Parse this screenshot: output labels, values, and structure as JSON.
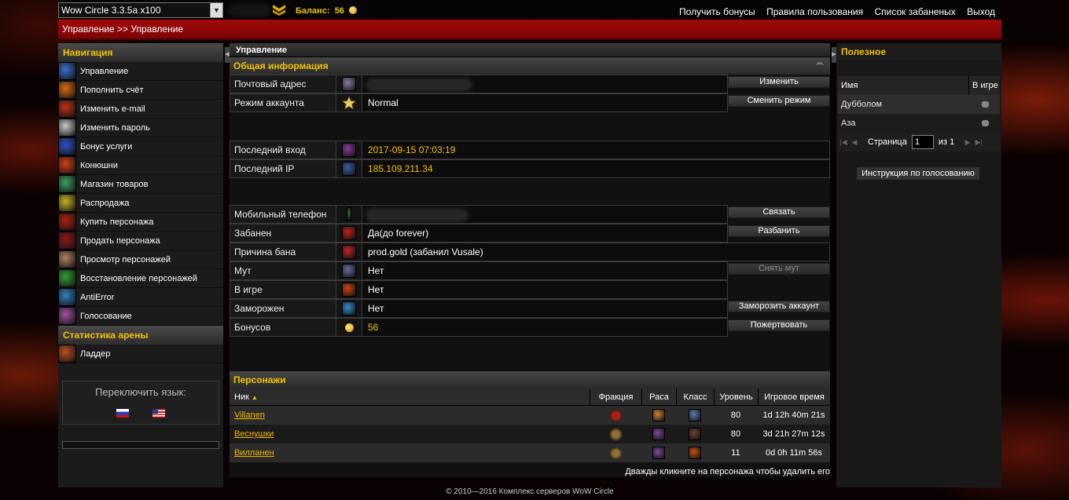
{
  "topbar": {
    "server_select": "Wow Circle 3.3.5a x100",
    "balance_label": "Баланс:",
    "balance_value": "56",
    "links": [
      "Получить бонусы",
      "Правила пользования",
      "Список забаненых",
      "Выход"
    ]
  },
  "breadcrumb": "Управление >> Управление",
  "left": {
    "nav_title": "Навигация",
    "nav_items": [
      {
        "label": "Управление",
        "icon": "management-icon",
        "color": "#3a6fd0"
      },
      {
        "label": "Пополнить счёт",
        "icon": "deposit-icon",
        "color": "#d86a10"
      },
      {
        "label": "Изменить e-mail",
        "icon": "email-icon",
        "color": "#c03010"
      },
      {
        "label": "Изменить пароль",
        "icon": "password-icon",
        "color": "#c8c8c8"
      },
      {
        "label": "Бонус услуги",
        "icon": "bonus-services-icon",
        "color": "#3050c8"
      },
      {
        "label": "Конюшни",
        "icon": "stables-icon",
        "color": "#d04010"
      },
      {
        "label": "Магазин товаров",
        "icon": "shop-icon",
        "color": "#3aa060"
      },
      {
        "label": "Распродажа",
        "icon": "sale-icon",
        "color": "#c8b020"
      },
      {
        "label": "Купить персонажа",
        "icon": "buy-character-icon",
        "color": "#b02010"
      },
      {
        "label": "Продать персонажа",
        "icon": "sell-character-icon",
        "color": "#901818"
      },
      {
        "label": "Просмотр персонажей",
        "icon": "view-characters-icon",
        "color": "#b08060"
      },
      {
        "label": "Восстановление персонажей",
        "icon": "restore-characters-icon",
        "color": "#30a030"
      },
      {
        "label": "AntiError",
        "icon": "antierror-icon",
        "color": "#3080c0"
      },
      {
        "label": "Голосование",
        "icon": "voting-icon",
        "color": "#a050a0"
      }
    ],
    "arena_title": "Статистика арены",
    "arena_items": [
      {
        "label": "Ладдер",
        "icon": "ladder-icon",
        "color": "#c05020"
      }
    ],
    "lang_title": "Переключить язык:"
  },
  "center": {
    "panel_title": "Управление",
    "general_title": "Общая информация",
    "rows": {
      "email": {
        "label": "Почтовый адрес",
        "button": "Изменить",
        "icon_color": "#8a7aa0"
      },
      "mode": {
        "label": "Режим аккаунта",
        "value": "Normal",
        "button": "Сменить режим"
      },
      "last_login": {
        "label": "Последний вход",
        "value": "2017-09-15 07:03:19",
        "icon_color": "#8a3a9a"
      },
      "last_ip": {
        "label": "Последний IP",
        "value": "185.109.211.34",
        "icon_color": "#3a5aa0"
      },
      "phone": {
        "label": "Мобильный телефон",
        "button": "Связать",
        "icon_color": "#2a6a2a"
      },
      "banned": {
        "label": "Забанен",
        "value": "Да(до forever)",
        "button": "Разбанить",
        "icon_color": "#c02020"
      },
      "ban_reason": {
        "label": "Причина бана",
        "value": "prod.gold (забанил Vusale)",
        "icon_color": "#c02020"
      },
      "mute": {
        "label": "Мут",
        "value": "Нет",
        "button": "Снять мут",
        "icon_color": "#6a6aa0"
      },
      "in_game": {
        "label": "В игре",
        "value": "Нет",
        "icon_color": "#d04010"
      },
      "frozen": {
        "label": "Заморожен",
        "value": "Нет",
        "button": "Заморозить аккаунт",
        "icon_color": "#3090d0"
      },
      "bonuses": {
        "label": "Бонусов",
        "value": "56",
        "button": "Пожертвовать"
      }
    },
    "chars_title": "Персонажи",
    "chars_columns": [
      "Ник",
      "Фракция",
      "Раса",
      "Класс",
      "Уровень",
      "Игровое время"
    ],
    "sort_indicator": "▲",
    "characters": [
      {
        "name": "Villanen",
        "level": "80",
        "time": "1d 12h 40m 21s",
        "faction_color": "#b02010",
        "race_color": "#d08030",
        "class_color": "#5a7ab0"
      },
      {
        "name": "Веснушки",
        "level": "80",
        "time": "3d 21h 27m 12s",
        "faction_color": "#907030",
        "race_color": "#7a4a9a",
        "class_color": "#704030"
      },
      {
        "name": "Вилланен",
        "level": "11",
        "time": "0d 0h 11m 56s",
        "faction_color": "#907030",
        "race_color": "#7a4a9a",
        "class_color": "#c05010"
      }
    ],
    "hint": "Дважды кликните на персонажа чтобы удалить его"
  },
  "right": {
    "title": "Полезное",
    "col_name": "Имя",
    "col_ingame": "В игре",
    "rows": [
      "Дубболом",
      "Аза"
    ],
    "page_label": "Страница",
    "page_value": "1",
    "page_of": "из 1",
    "vote_button": "Инструкция по голосованию"
  },
  "footer": "© 2010—2016 Комплекс серверов WoW Circle",
  "colors": {
    "accent_gold": "#f2c200",
    "brand_red": "#a10909",
    "link_gold": "#f0b800"
  }
}
